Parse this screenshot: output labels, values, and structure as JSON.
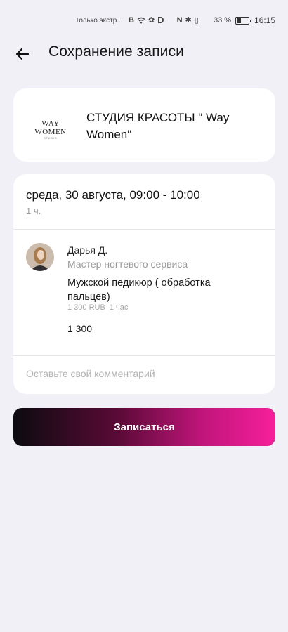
{
  "status_bar": {
    "left_text": "Только экстр...",
    "battery_percent": "33 %",
    "battery_level": 0.33,
    "time": "16:15"
  },
  "header": {
    "back_icon": "arrow-left-icon",
    "title": "Сохранение записи"
  },
  "studio": {
    "logo_text": "WAY WOMEN",
    "logo_subtext": "STUDIO",
    "name": "СТУДИЯ КРАСОТЫ \" Way Women\""
  },
  "booking": {
    "date_time": "среда, 30 августа, 09:00 - 10:00",
    "duration": "1 ч.",
    "master": {
      "name": "Дарья Д.",
      "role": "Мастер ногтевого сервиса"
    },
    "service": {
      "name": "Мужской педикюр ( обработка пальцев)",
      "price": "1 300 RUB",
      "duration": "1 час"
    },
    "total": "1 300",
    "comment": {
      "value": "",
      "placeholder": "Оставьте свой комментарий"
    }
  },
  "submit_label": "Записаться",
  "colors": {
    "background": "#f1f0f6",
    "gradient_start": "#0b0b0f",
    "gradient_end": "#f61f9b"
  }
}
